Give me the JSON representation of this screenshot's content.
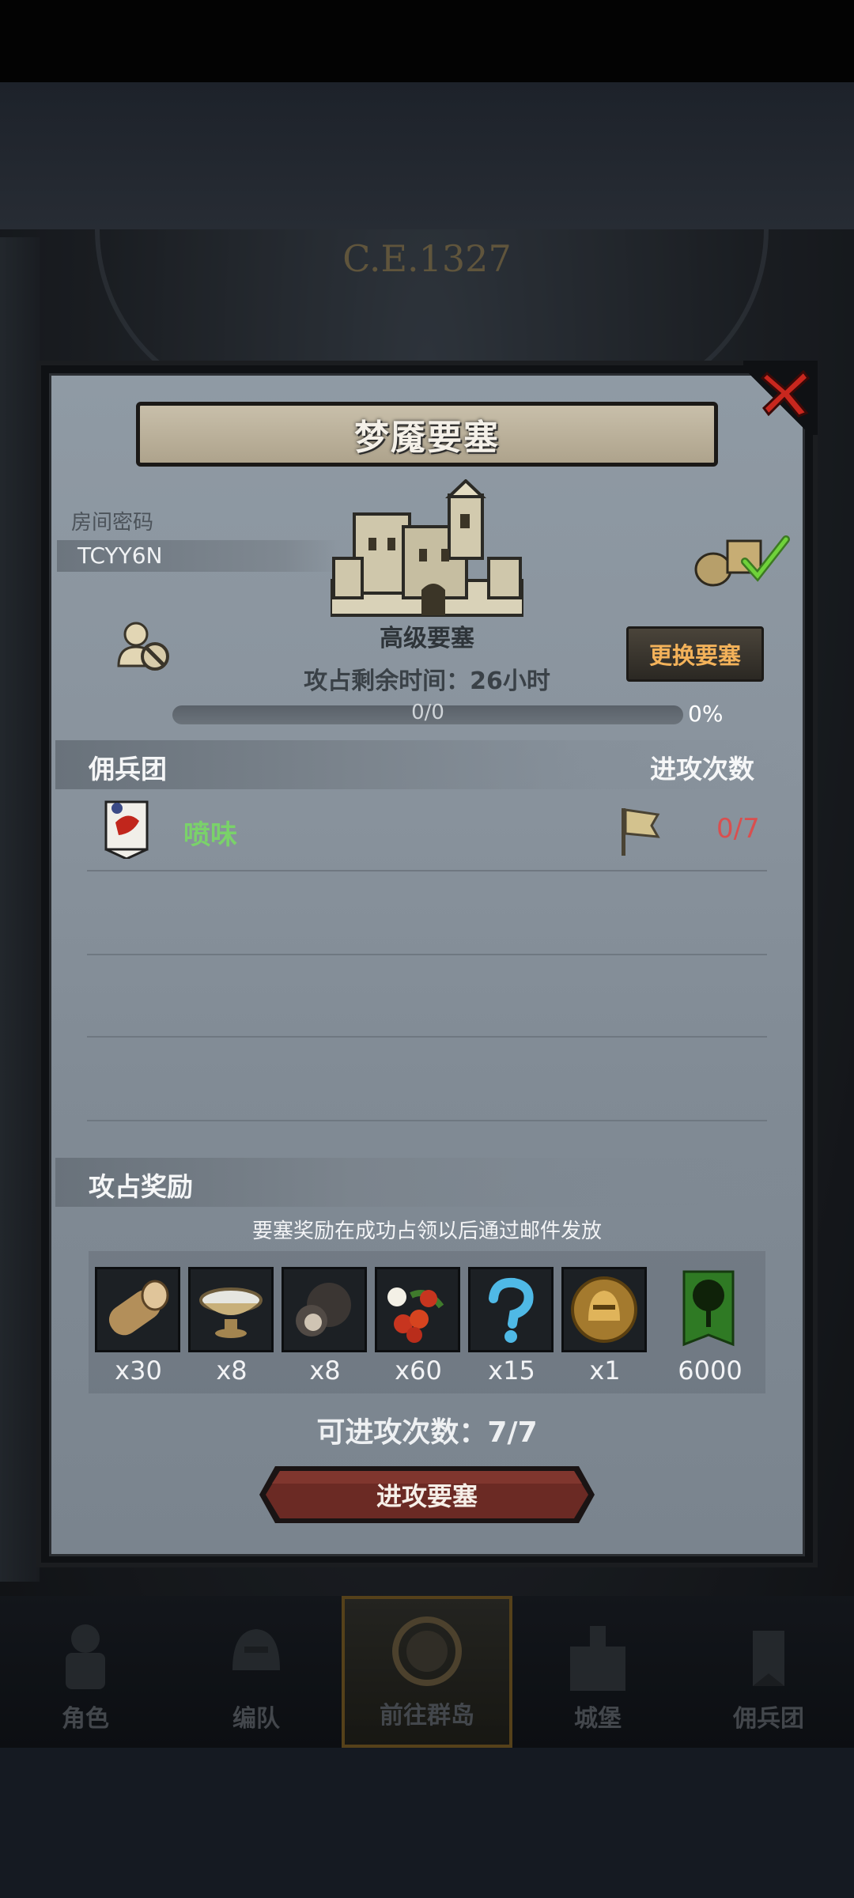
{
  "background": {
    "era_label": "C.E.1327"
  },
  "dialog": {
    "title": "梦魇要塞",
    "room_password_label": "房间密码",
    "room_password": "TCYY6N",
    "fortress_name": "高级要塞",
    "time_remaining": "攻占剩余时间：26小时",
    "progress_text": "0/0",
    "progress_percent": "0%",
    "change_button": "更换要塞",
    "mercenary_header": "佣兵团",
    "attack_count_header": "进攻次数",
    "guilds": [
      {
        "name": "喷味",
        "attacks": "0/7"
      }
    ],
    "reward_header": "攻占奖励",
    "reward_note": "要塞奖励在成功占领以后通过邮件发放",
    "rewards": [
      {
        "icon": "log-icon",
        "count": "x30"
      },
      {
        "icon": "bowl-icon",
        "count": "x8"
      },
      {
        "icon": "truffle-icon",
        "count": "x8"
      },
      {
        "icon": "berries-icon",
        "count": "x60"
      },
      {
        "icon": "mystery-question-icon",
        "count": "x15"
      },
      {
        "icon": "helmet-medal-icon",
        "count": "x1"
      },
      {
        "icon": "tree-banner-icon",
        "count": "6000"
      }
    ],
    "attacks_available": "可进攻次数：7/7",
    "attack_button": "进攻要塞"
  },
  "nav": {
    "items": [
      {
        "label": "角色",
        "icon": "knight-icon"
      },
      {
        "label": "编队",
        "icon": "helmet-icon"
      },
      {
        "label": "前往群岛",
        "icon": "compass-icon"
      },
      {
        "label": "城堡",
        "icon": "castle-icon"
      },
      {
        "label": "佣兵团",
        "icon": "mercenary-icon"
      }
    ]
  },
  "colors": {
    "panel": "#8a949e",
    "accent_orange": "#f3b25a",
    "guild_green": "#7ad26a",
    "attack_red": "#d94f4f",
    "button_red": "#6b2a24"
  }
}
